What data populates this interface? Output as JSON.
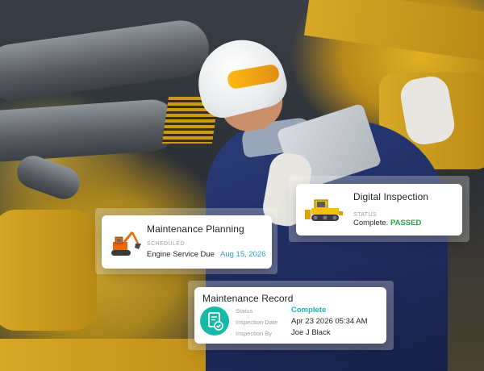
{
  "cards": {
    "digital_inspection": {
      "title": "Digital Inspection",
      "status_label": "STATUS",
      "status_text": "Complete.",
      "status_result": "PASSED",
      "icon": "bulldozer-icon"
    },
    "maintenance_planning": {
      "title": "Maintenance Planning",
      "scheduled_label": "SCHEDULED",
      "task": "Engine Service Due",
      "date": "Aug 15, 2026",
      "icon": "excavator-icon"
    },
    "maintenance_record": {
      "title": "Maintenance Record",
      "icon": "document-check-icon",
      "rows": [
        {
          "label": "Status",
          "value": "Complete"
        },
        {
          "label": "Inspection Date",
          "value": "Apr 23 2026 05:34 AM"
        },
        {
          "label": "Inspection By",
          "value": "Joe J Black"
        }
      ]
    }
  },
  "colors": {
    "accent_teal": "#16b8a6",
    "passed_green": "#2aa14a",
    "date_blue": "#2aa0c8",
    "machinery_yellow": "#e0b021"
  }
}
